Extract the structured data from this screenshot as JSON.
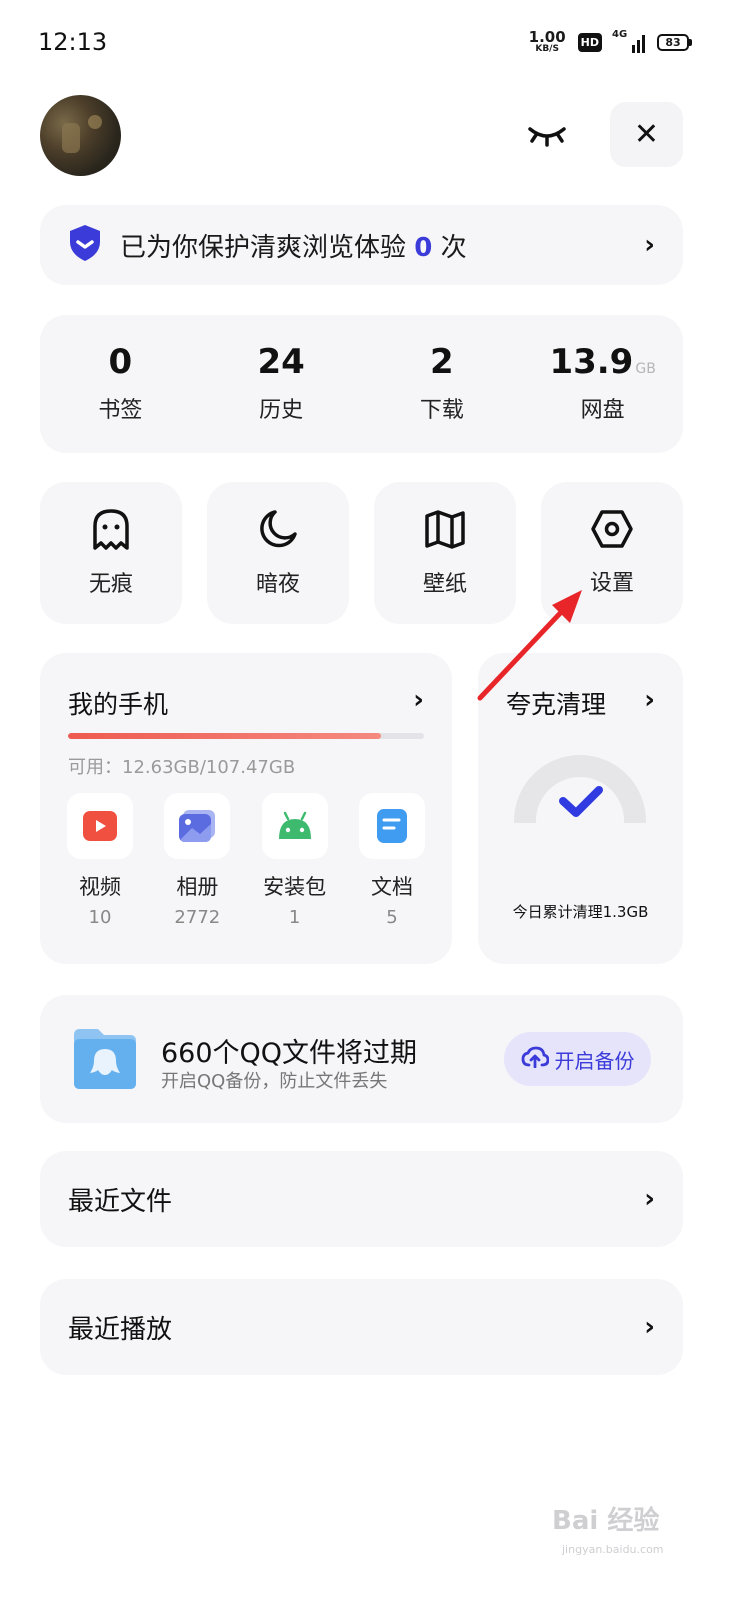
{
  "status_bar": {
    "time": "12:13",
    "net_speed": "1.00",
    "net_unit": "KB/S",
    "hd": "HD",
    "signal": "4G",
    "battery": "83"
  },
  "header": {
    "avatar": "avatar",
    "eye_icon": "closed-eye-icon",
    "close_label": "✕"
  },
  "protect": {
    "text_before": "已为你保护清爽浏览体验",
    "count": "0",
    "text_after": "次"
  },
  "stats": [
    {
      "value": "0",
      "unit": "",
      "label": "书签"
    },
    {
      "value": "24",
      "unit": "",
      "label": "历史"
    },
    {
      "value": "2",
      "unit": "",
      "label": "下载"
    },
    {
      "value": "13.9",
      "unit": "GB",
      "label": "网盘"
    }
  ],
  "tools": [
    {
      "label": "无痕",
      "icon": "ghost-icon"
    },
    {
      "label": "暗夜",
      "icon": "moon-icon"
    },
    {
      "label": "壁纸",
      "icon": "book-icon"
    },
    {
      "label": "设置",
      "icon": "hexagon-settings-icon"
    }
  ],
  "my_phone": {
    "title": "我的手机",
    "storage_text": "可用：12.63GB/107.47GB",
    "storage_used_fraction": 0.88,
    "types": [
      {
        "name": "视频",
        "count": "10",
        "icon": "video-icon"
      },
      {
        "name": "相册",
        "count": "2772",
        "icon": "photo-icon"
      },
      {
        "name": "安装包",
        "count": "1",
        "icon": "android-icon"
      },
      {
        "name": "文档",
        "count": "5",
        "icon": "document-icon"
      }
    ]
  },
  "cleaner": {
    "title": "夸克清理",
    "summary": "今日累计清理1.3GB"
  },
  "qq_backup": {
    "title": "660个QQ文件将过期",
    "subtitle": "开启QQ备份，防止文件丢失",
    "button": "开启备份"
  },
  "recent_files": {
    "label": "最近文件"
  },
  "recent_play": {
    "label": "最近播放"
  },
  "watermark": {
    "brand": "Bai 经验",
    "url": "jingyan.baidu.com"
  },
  "colors": {
    "accent": "#3b3bd9",
    "card_bg": "#f6f6f8",
    "storage_bar": "#ee5a4f",
    "annotation": "#e8262a"
  }
}
